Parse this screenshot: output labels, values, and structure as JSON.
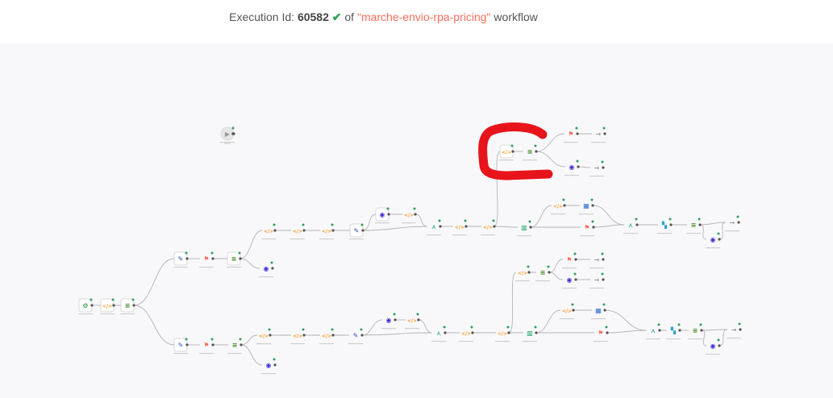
{
  "header": {
    "label": "Execution Id:",
    "execution_id": "60582",
    "of_text": "of",
    "workflow_name": "\"marche-envio-rpa-pricing\"",
    "suffix": "workflow"
  },
  "colors": {
    "success": "#2ca05a",
    "workflow_name": "#ff6d5a",
    "annotation": "#e8141b",
    "canvas_bg": "#f8f8fb",
    "connection": "#b5b5b5"
  },
  "canvas": {
    "start_node_label": "Start",
    "annotation": "red-bracket-stroke"
  }
}
